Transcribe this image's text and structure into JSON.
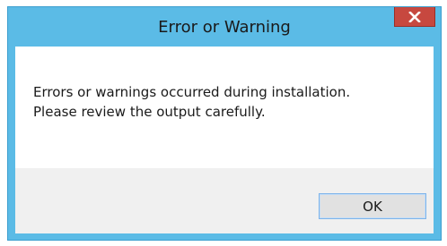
{
  "window": {
    "title": "Error or Warning"
  },
  "message": {
    "line1": "Errors or warnings occurred during installation.",
    "line2": "Please review the output carefully."
  },
  "buttons": {
    "ok_label": "OK"
  },
  "icons": {
    "close": "close-icon"
  },
  "colors": {
    "frame": "#5bbbe6",
    "close_button": "#c7483f",
    "content_bg": "#ffffff",
    "footer_bg": "#f0f0f0"
  }
}
